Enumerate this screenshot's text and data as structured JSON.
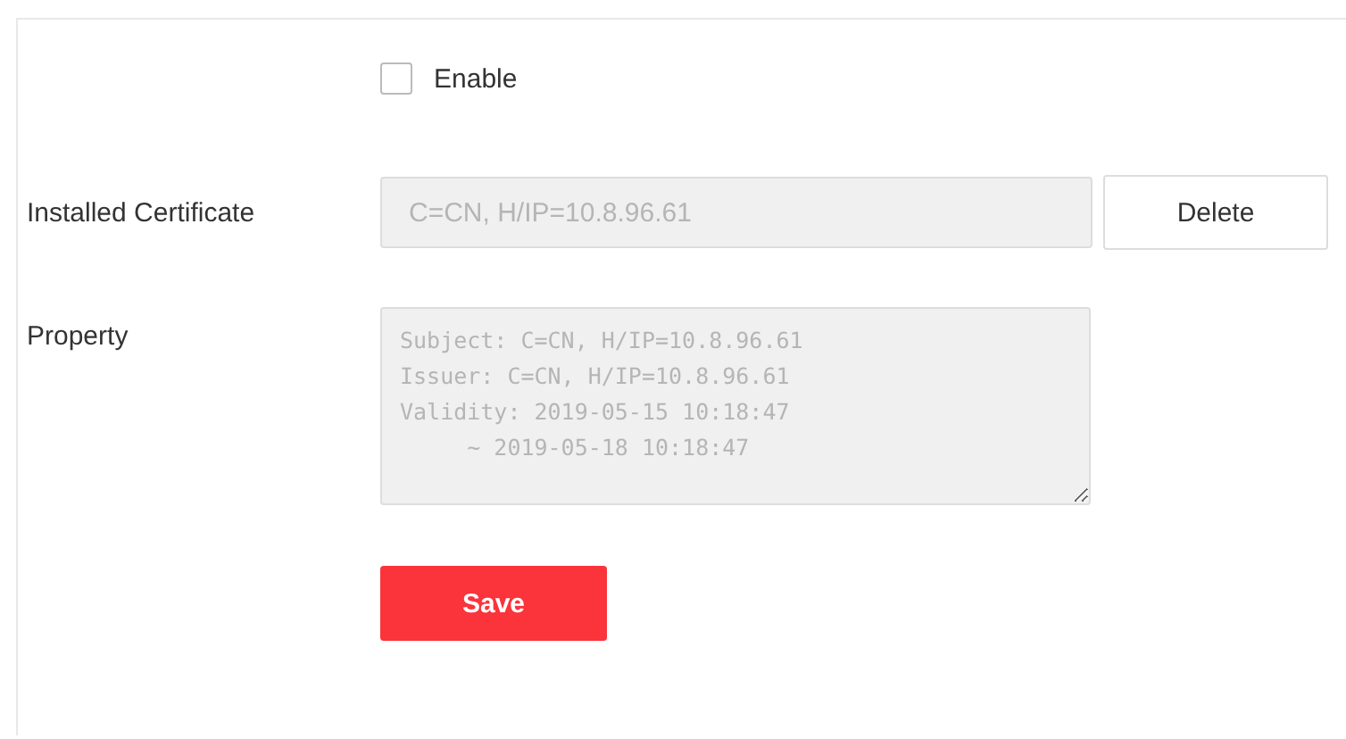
{
  "enable": {
    "label": "Enable",
    "checked": false
  },
  "installed_certificate": {
    "label": "Installed Certificate",
    "value": "C=CN, H/IP=10.8.96.61",
    "disabled": true,
    "button": "Delete"
  },
  "property": {
    "label": "Property",
    "lines": [
      "Subject: C=CN, H/IP=10.8.96.61",
      "Issuer: C=CN, H/IP=10.8.96.61",
      "Validity: 2019-05-15 10:18:47",
      "     ~ 2019-05-18 10:18:47"
    ],
    "disabled": true
  },
  "save_button": "Save"
}
